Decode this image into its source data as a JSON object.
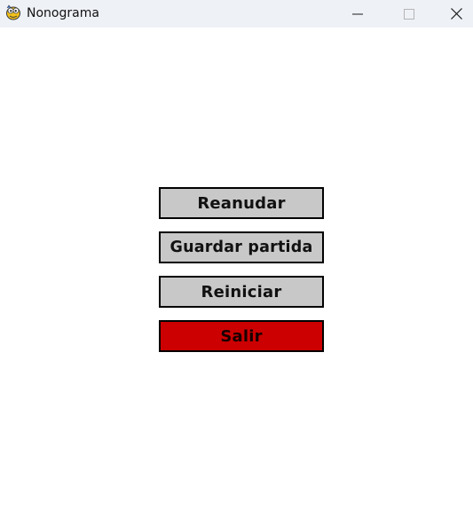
{
  "window": {
    "title": "Nonograma",
    "app_icon": "pygame-snake-icon",
    "controls": {
      "minimize_icon": "minimize-icon",
      "maximize_icon": "maximize-icon",
      "close_icon": "close-icon"
    }
  },
  "menu": {
    "items": [
      {
        "label": "Reanudar",
        "color": "#c8c8c8"
      },
      {
        "label": "Guardar partida",
        "color": "#c8c8c8"
      },
      {
        "label": "Reiniciar",
        "color": "#c8c8c8"
      },
      {
        "label": "Salir",
        "color": "#cc0000"
      }
    ]
  }
}
